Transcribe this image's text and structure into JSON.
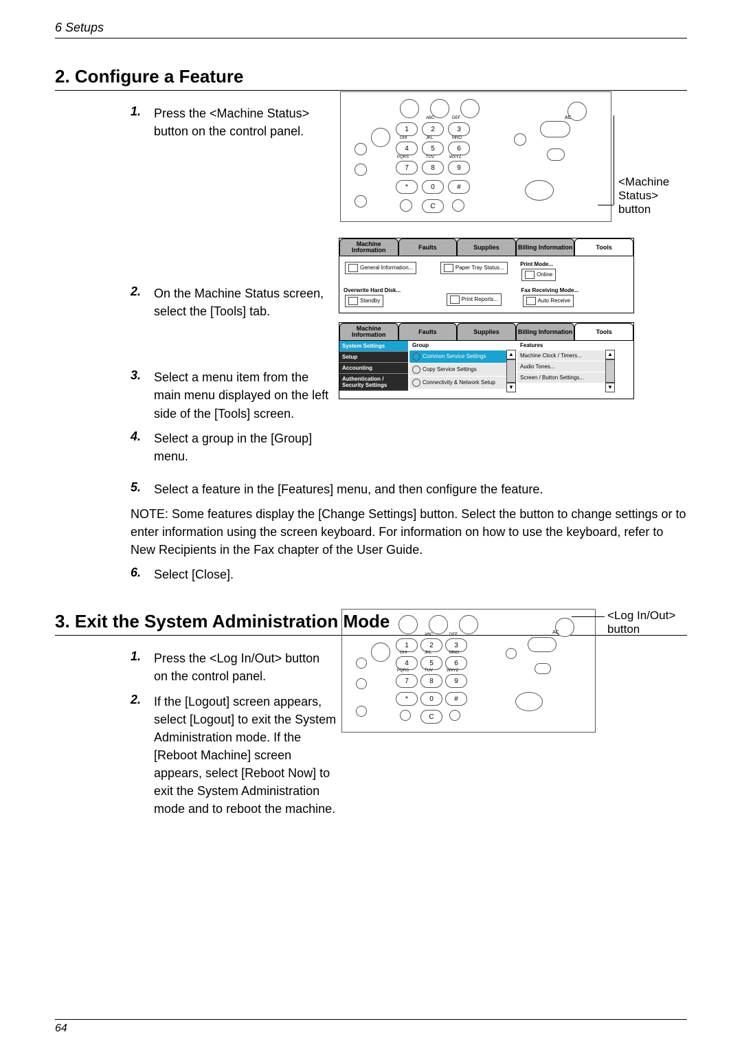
{
  "header": {
    "chapter": "6  Setups"
  },
  "section2": {
    "heading": "2. Configure a Feature",
    "steps": {
      "s1": {
        "num": "1.",
        "text": "Press the <Machine Status> button on the control panel."
      },
      "s2": {
        "num": "2.",
        "text": "On the Machine Status screen, select the [Tools] tab."
      },
      "s3": {
        "num": "3.",
        "text": "Select a menu item from the main menu displayed on the left side of the [Tools] screen."
      },
      "s4": {
        "num": "4.",
        "text": "Select a group in the [Group] menu."
      },
      "s5": {
        "num": "5.",
        "text": "Select a feature in the [Features] menu, and then configure the feature."
      },
      "note": "NOTE: Some features display the [Change Settings] button. Select the button to change settings or to enter information using the screen keyboard. For information on how to use the keyboard, refer to New Recipients in the Fax chapter of the User Guide.",
      "s6": {
        "num": "6.",
        "text": "Select [Close]."
      }
    },
    "callout1": "<Machine Status> button",
    "screen1": {
      "tabs": {
        "t1": "Machine Information",
        "t2": "Faults",
        "t3": "Supplies",
        "t4": "Billing Information",
        "t5": "Tools"
      },
      "btns": {
        "gen": "General Information...",
        "paper": "Paper Tray Status...",
        "printmode_h": "Print Mode...",
        "printmode_v": "Online",
        "overwrite_h": "Overwrite Hard Disk...",
        "overwrite_v": "Standby",
        "reports": "Print Reports...",
        "faxmode_h": "Fax Receiving Mode...",
        "faxmode_v": "Auto Receive"
      }
    },
    "screen2": {
      "tabs": {
        "t1": "Machine Information",
        "t2": "Faults",
        "t3": "Supplies",
        "t4": "Billing Information",
        "t5": "Tools"
      },
      "side": {
        "i1": "System Settings",
        "i2": "Setup",
        "i3": "Accounting",
        "i4": "Authentication / Security Settings"
      },
      "midHeader": "Group",
      "mid": {
        "m1": "Common Service Settings",
        "m2": "Copy Service Settings",
        "m3": "Connectivity & Network Setup"
      },
      "rightHeader": "Features",
      "right": {
        "r1": "Machine Clock / Timers...",
        "r2": "Audio Tones...",
        "r3": "Screen / Button Settings..."
      }
    },
    "keypad": {
      "k1": "1",
      "k2": "2",
      "k3": "3",
      "k4": "4",
      "k5": "5",
      "k6": "6",
      "k7": "7",
      "k8": "8",
      "k9": "9",
      "ks": "*",
      "k0": "0",
      "kh": "#",
      "kc": "C"
    },
    "tiny": {
      "abc": "ABC",
      "def": "DEF",
      "ghi": "GHI",
      "jkl": "JKL",
      "mno": "MNO",
      "pqrs": "PQRS",
      "tuv": "TUV",
      "wxyz": "WXYZ",
      "ac": "AC"
    }
  },
  "section3": {
    "heading": "3. Exit the System Administration Mode",
    "steps": {
      "s1": {
        "num": "1.",
        "text": "Press the <Log In/Out> button on the control panel."
      },
      "s2": {
        "num": "2.",
        "text": "If the [Logout] screen appears, select [Logout] to exit the System Administration mode. If the [Reboot Machine] screen appears, select [Reboot Now] to exit the System Administration mode and to reboot the machine."
      }
    },
    "callout": "<Log In/Out> button"
  },
  "pageNumber": "64"
}
